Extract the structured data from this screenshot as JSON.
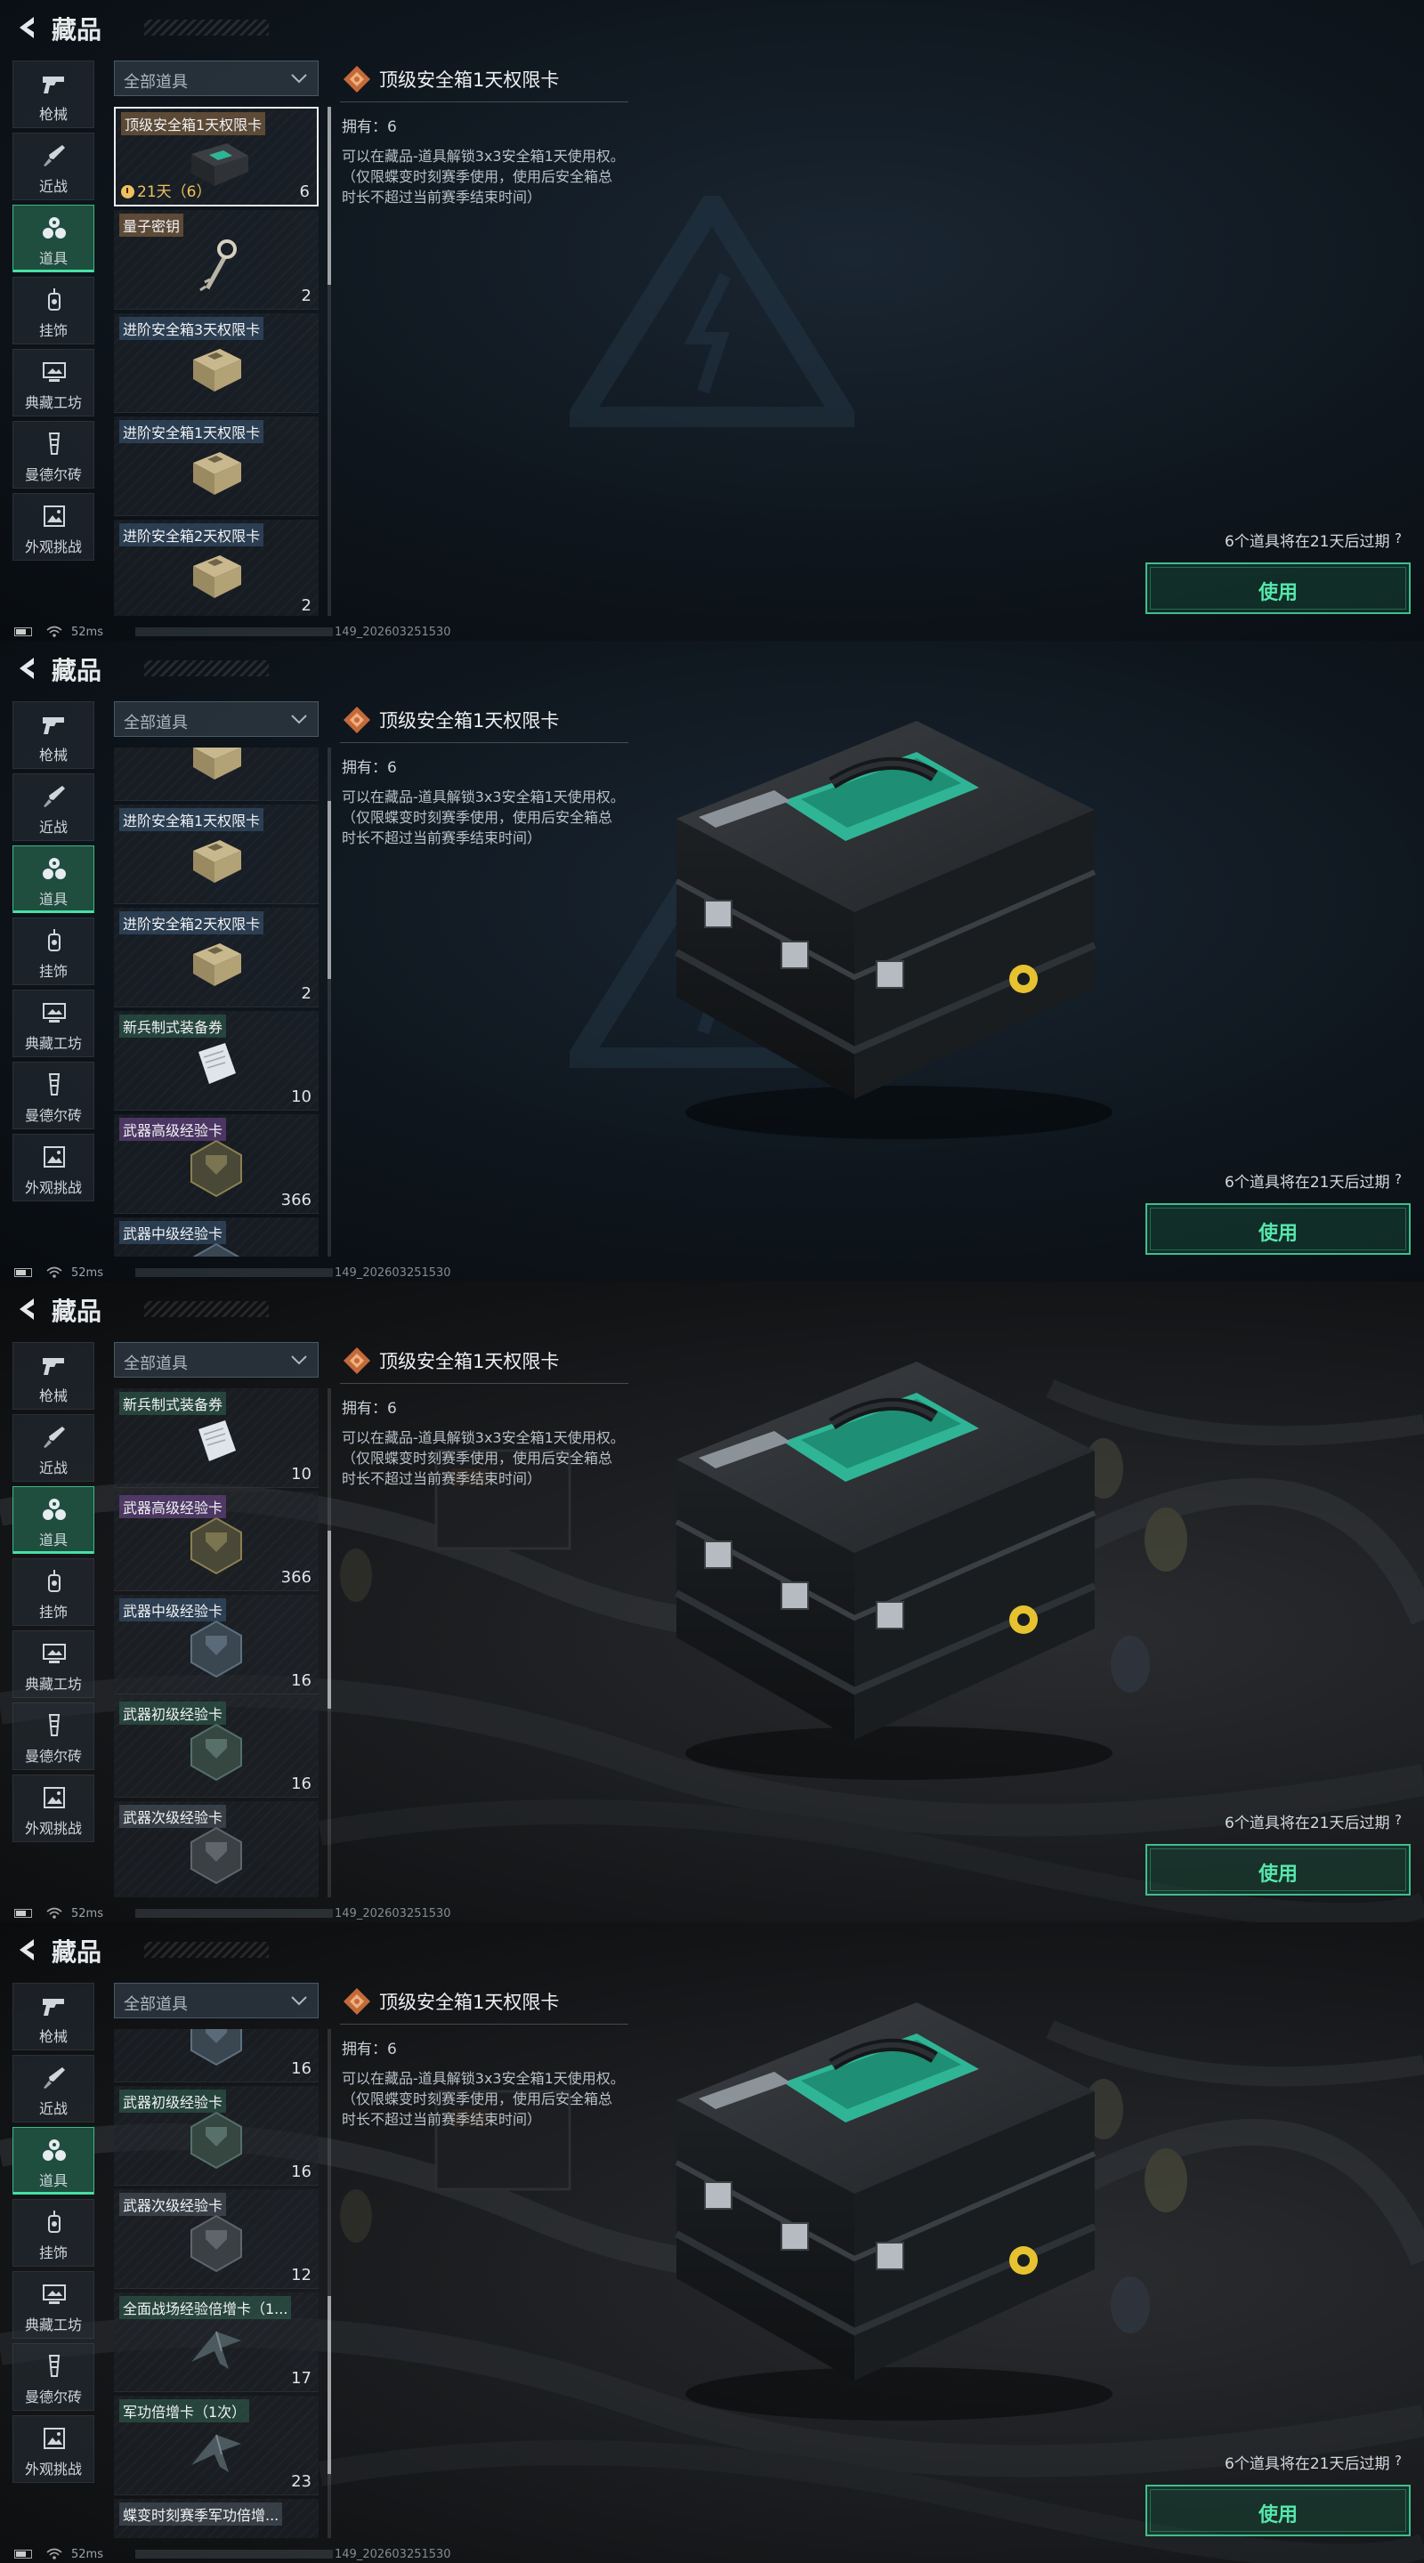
{
  "header": {
    "title": "藏品"
  },
  "nav": [
    {
      "label": "枪械",
      "icon": "pistol-icon"
    },
    {
      "label": "近战",
      "icon": "knife-icon"
    },
    {
      "label": "道具",
      "icon": "items-icon",
      "active": true
    },
    {
      "label": "挂饰",
      "icon": "charm-icon"
    },
    {
      "label": "典藏工坊",
      "icon": "workshop-icon"
    },
    {
      "label": "曼德尔砖",
      "icon": "brick-icon"
    },
    {
      "label": "外观挑战",
      "icon": "challenge-icon"
    }
  ],
  "filter": {
    "label": "全部道具"
  },
  "detail": {
    "title": "顶级安全箱1天权限卡",
    "owned": "拥有：6",
    "description": "可以在藏品-道具解锁3x3安全箱1天使用权。（仅限蝶变时刻赛季使用，使用后安全箱总时长不超过当前赛季结束时间）"
  },
  "expire_note": "6个道具将在21天后过期",
  "help": "?",
  "use_button": "使用",
  "status": {
    "ping": "52ms",
    "build": "149_202603251530"
  },
  "panels": [
    {
      "scene": false,
      "show_case": false,
      "items": [
        {
          "name": "顶级安全箱1天权限卡",
          "tag": "gold",
          "count": "6",
          "expiry": "21天（6）",
          "selected": true,
          "img": "case"
        },
        {
          "name": "量子密钥",
          "tag": "gold",
          "count": "2",
          "img": "key"
        },
        {
          "name": "进阶安全箱3天权限卡",
          "tag": "blue",
          "count": "",
          "img": "box"
        },
        {
          "name": "进阶安全箱1天权限卡",
          "tag": "blue",
          "count": "",
          "img": "box"
        },
        {
          "name": "进阶安全箱2天权限卡",
          "tag": "blue",
          "count": "2",
          "img": "box"
        }
      ]
    },
    {
      "scene": false,
      "show_case": true,
      "items": [
        {
          "name": "",
          "tag": "",
          "count": "",
          "img": "box",
          "partial": true
        },
        {
          "name": "进阶安全箱1天权限卡",
          "tag": "blue",
          "count": "",
          "img": "box"
        },
        {
          "name": "进阶安全箱2天权限卡",
          "tag": "blue",
          "count": "2",
          "img": "box"
        },
        {
          "name": "新兵制式装备券",
          "tag": "green",
          "count": "10",
          "img": "paper"
        },
        {
          "name": "武器高级经验卡",
          "tag": "purple",
          "count": "366",
          "img": "hex-gold"
        },
        {
          "name": "武器中级经验卡",
          "tag": "blue",
          "count": "",
          "img": "hex-blue"
        }
      ]
    },
    {
      "scene": true,
      "show_case": true,
      "items": [
        {
          "name": "新兵制式装备券",
          "tag": "green",
          "count": "10",
          "img": "paper"
        },
        {
          "name": "武器高级经验卡",
          "tag": "purple",
          "count": "366",
          "img": "hex-gold"
        },
        {
          "name": "武器中级经验卡",
          "tag": "blue",
          "count": "16",
          "img": "hex-blue"
        },
        {
          "name": "武器初级经验卡",
          "tag": "green",
          "count": "16",
          "img": "hex-green"
        },
        {
          "name": "武器次级经验卡",
          "tag": "gray",
          "count": "",
          "img": "hex-gray"
        }
      ]
    },
    {
      "scene": true,
      "show_case": true,
      "items": [
        {
          "name": "",
          "tag": "",
          "count": "16",
          "img": "hex-blue",
          "partial": true
        },
        {
          "name": "武器初级经验卡",
          "tag": "green",
          "count": "16",
          "img": "hex-green"
        },
        {
          "name": "武器次级经验卡",
          "tag": "gray",
          "count": "12",
          "img": "hex-gray"
        },
        {
          "name": "全面战场经验倍增卡（1...",
          "tag": "green",
          "count": "17",
          "img": "plane"
        },
        {
          "name": "军功倍增卡（1次）",
          "tag": "green",
          "count": "23",
          "img": "plane"
        },
        {
          "name": "蝶变时刻赛季军功倍增...",
          "tag": "gray",
          "count": "",
          "img": "plane"
        }
      ]
    }
  ]
}
